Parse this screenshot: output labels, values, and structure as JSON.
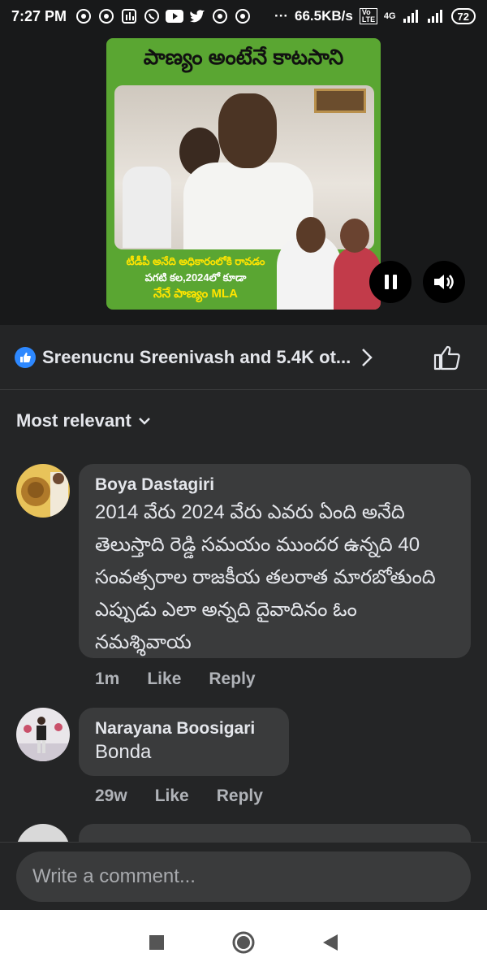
{
  "status_bar": {
    "time": "7:27 PM",
    "dots": "···",
    "net_speed": "66.5KB/s",
    "volte": "Vo LTE",
    "network": "4G",
    "battery": "72"
  },
  "video": {
    "headline": "పాణ్యం అంటేనే కాటసాని",
    "caption_line1": "టీడీపీ అనేది అధికారంలోకి రావడం",
    "caption_line2": "పగటి కల,2024లో కూడా",
    "caption_line3": "నేనే పాణ్యం MLA",
    "accent_green": "#5aa632"
  },
  "reactions": {
    "text": "Sreenucnu Sreenivash and 5.4K ot..."
  },
  "sort": {
    "label": "Most relevant"
  },
  "comments": [
    {
      "author": "Boya Dastagiri",
      "text": "2014 వేరు 2024 వేరు ఎవరు ఏంది అనేది తెలుస్తాది రెడ్డి సమయం ముందర ఉన్నది 40 సంవత్సరాల రాజకీయ తలరాత మారబోతుంది ఎప్పుడు ఎలా అన్నది దైవాదినం ఓం నమశ్శివాయ",
      "time": "1m",
      "like": "Like",
      "reply": "Reply"
    },
    {
      "author": "Narayana Boosigari",
      "text": "Bonda",
      "time": "29w",
      "like": "Like",
      "reply": "Reply"
    }
  ],
  "composer": {
    "placeholder": "Write a comment..."
  }
}
